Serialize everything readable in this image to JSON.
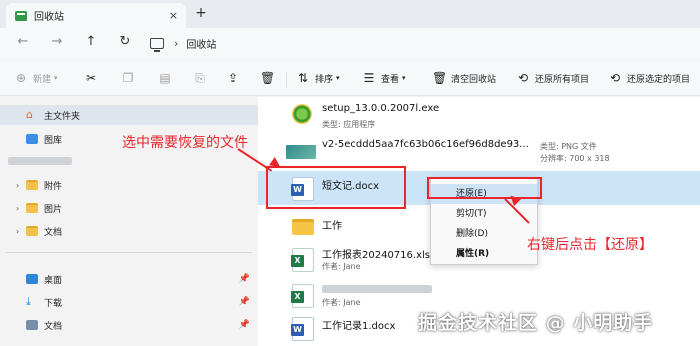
{
  "window": {
    "tab_title": "回收站",
    "tab_close": "×",
    "new_tab": "+"
  },
  "address": {
    "breadcrumb": "回收站",
    "separator": "›"
  },
  "toolbar": {
    "new_label": "新建",
    "sort_label": "排序",
    "view_label": "查看",
    "empty_label": "清空回收站",
    "restore_all_label": "还原所有项目",
    "restore_selected_label": "还原选定的项目"
  },
  "sidebar": {
    "home": "主文件夹",
    "gallery": "图库",
    "folders": [
      "附件",
      "图片",
      "文档"
    ],
    "quick": [
      "桌面",
      "下载",
      "文档"
    ]
  },
  "files": [
    {
      "name": "setup_13.0.0.2007l.exe",
      "meta": "类型: 应用程序",
      "icon": "setup-icon"
    },
    {
      "name": "v2-5ecddd5aa7fc63b06c16ef96d8de93...",
      "meta": "",
      "side1": "类型: PNG 文件",
      "side2": "分辨率: 700 x 318",
      "icon": "image-icon"
    },
    {
      "name": "短文记.docx",
      "meta": "",
      "icon": "word-icon"
    },
    {
      "name": "工作",
      "meta": "",
      "icon": "folder-icon"
    },
    {
      "name": "工作报表20240716.xlsx",
      "meta": "作者: Jane",
      "icon": "excel-icon"
    },
    {
      "name": "",
      "meta": "作者: Jane",
      "icon": "excel-icon"
    },
    {
      "name": "工作记录1.docx",
      "meta": "",
      "icon": "word-icon"
    }
  ],
  "context_menu": {
    "restore": "还原(E)",
    "cut": "剪切(T)",
    "delete": "删除(D)",
    "properties": "属性(R)"
  },
  "annotations": {
    "select_note": "选中需要恢复的文件",
    "click_note": "右键后点击【还原】",
    "color": "#e8262b"
  },
  "watermark": "掘金技术社区 @ 小明助手"
}
